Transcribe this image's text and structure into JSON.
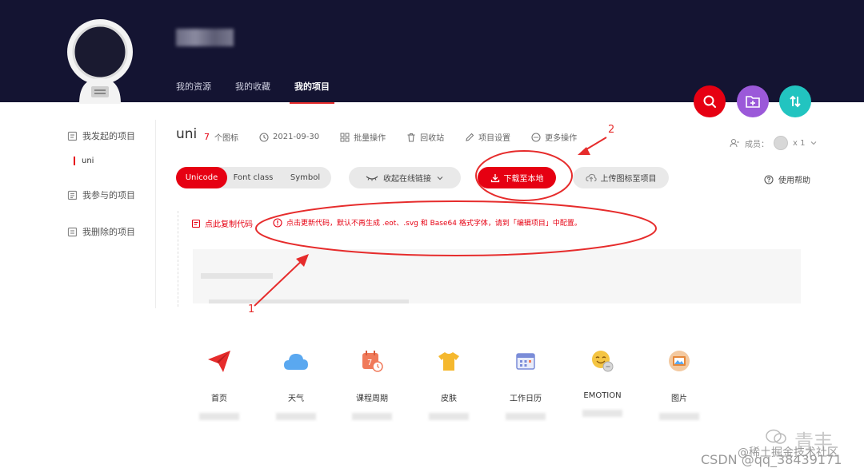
{
  "header": {
    "nav": [
      {
        "label": "我的资源"
      },
      {
        "label": "我的收藏"
      },
      {
        "label": "我的项目",
        "active": true
      }
    ]
  },
  "sidebar": {
    "items": [
      {
        "label": "我发起的项目",
        "icon": "document-icon"
      },
      {
        "label": "我参与的项目",
        "icon": "project-icon"
      },
      {
        "label": "我删除的项目",
        "icon": "trash-list-icon"
      }
    ],
    "active_project": "uni"
  },
  "project": {
    "name": "uni",
    "icon_count": "7",
    "icon_count_unit": "个图标",
    "date": "2021-09-30",
    "batch_label": "批量操作",
    "recycle_label": "回收站",
    "settings_label": "项目设置",
    "more_label": "更多操作",
    "members_label": "成员：",
    "members_count": "x 1"
  },
  "toolbar": {
    "formats": [
      "Unicode",
      "Font class",
      "Symbol"
    ],
    "selected_format": "Unicode",
    "collapse_label": "收起在线链接",
    "download_label": "下载至本地",
    "upload_label": "上传图标至项目",
    "help_label": "使用帮助"
  },
  "notice": {
    "copy_label": "点此复制代码",
    "update_text": "点击更新代码，默认不再生成 .eot、.svg 和 Base64 格式字体，请到「编辑项目」中配置。"
  },
  "icons": [
    {
      "name": "首页",
      "icon": "paper-plane-icon",
      "color": "#e62c2c"
    },
    {
      "name": "天气",
      "icon": "cloud-icon",
      "color": "#5aa8f0"
    },
    {
      "name": "课程周期",
      "icon": "calendar-clock-icon",
      "color": "#f07a5a"
    },
    {
      "name": "皮肤",
      "icon": "tshirt-icon",
      "color": "#f5b82e"
    },
    {
      "name": "工作日历",
      "icon": "work-calendar-icon",
      "color": "#7a8cd8"
    },
    {
      "name": "EMOTION",
      "icon": "emoji-icon",
      "color": "#f5c542"
    },
    {
      "name": "图片",
      "icon": "picture-icon",
      "color": "#e6883a"
    }
  ],
  "annotations": {
    "label_1": "1",
    "label_2": "2"
  },
  "watermark": {
    "brand": "青丰",
    "site": "@稀土掘金技术社区",
    "csdn": "CSDN @qq_38439171"
  },
  "colors": {
    "header_bg": "#141432",
    "accent_red": "#e60012",
    "purple": "#9b59d9",
    "teal": "#22c4c0"
  }
}
